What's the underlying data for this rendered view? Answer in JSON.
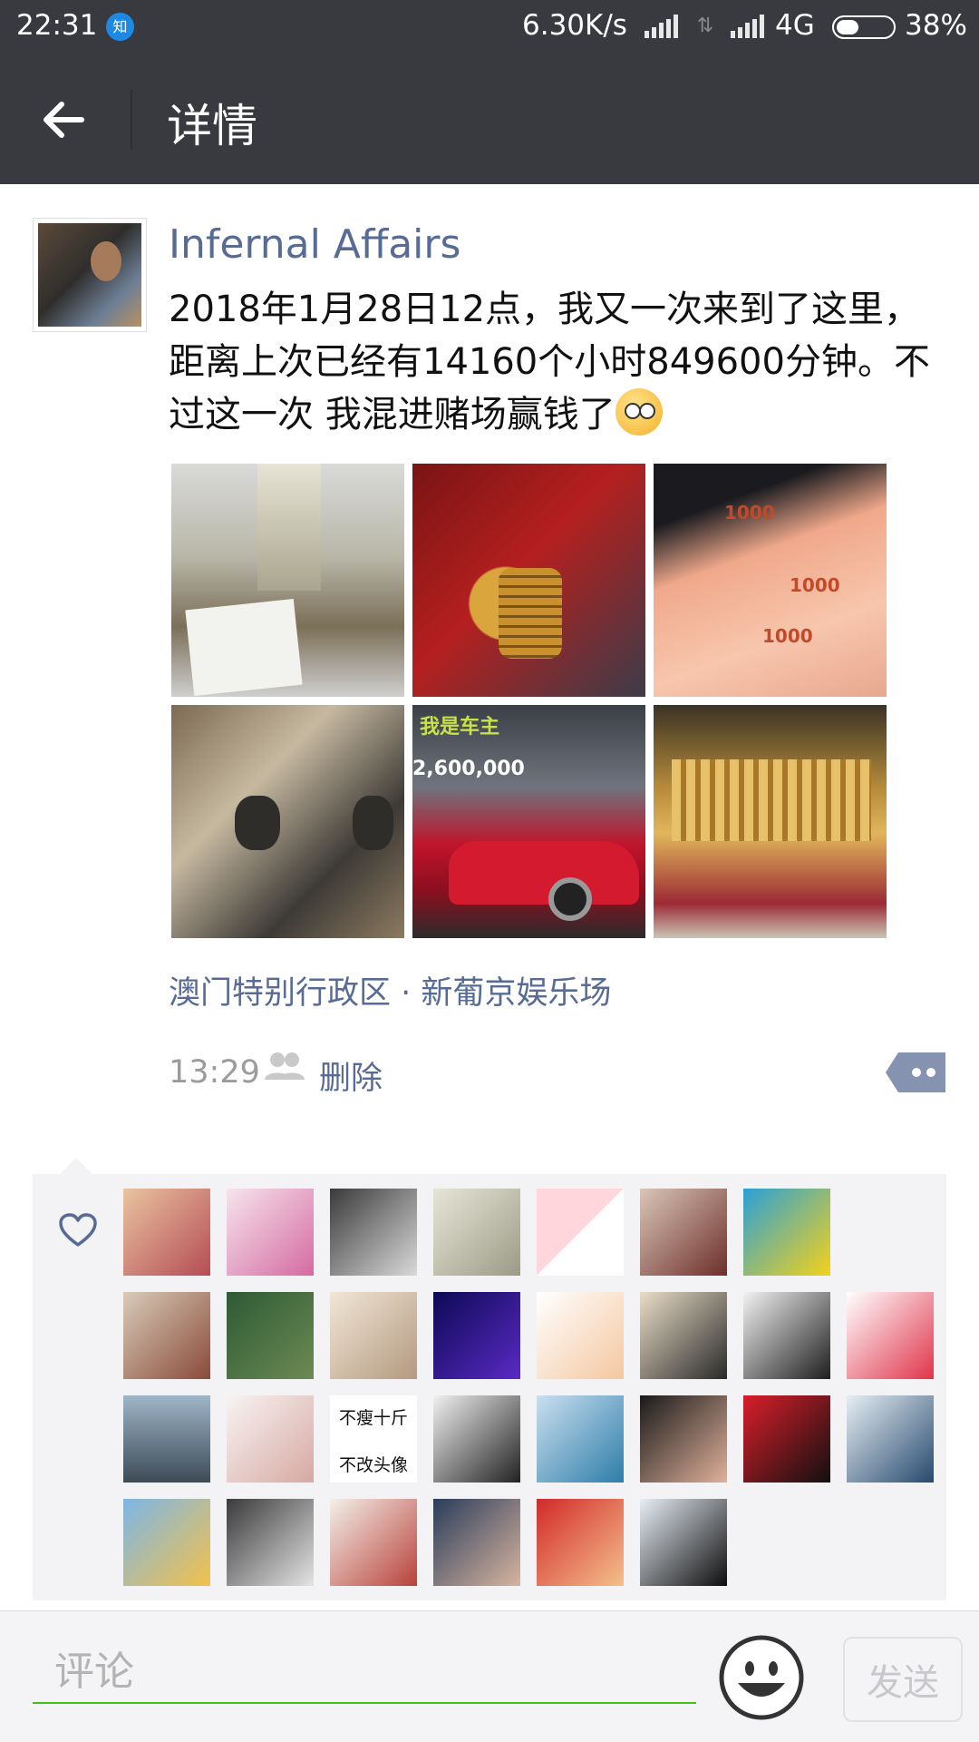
{
  "status_bar": {
    "time": "22:31",
    "app_badge": "知",
    "net_speed": "6.30K/s",
    "network_type": "4G",
    "battery_percent": "38%",
    "battery_level": 0.38
  },
  "header": {
    "title": "详情",
    "back_icon": "arrow-left-icon"
  },
  "post": {
    "author": "Infernal Affairs",
    "text": "2018年1月28日12点，我又一次来到了这里，距离上次已经有14160个小时849600分钟。不过这一次 我混进赌场赢钱了",
    "photo_captions": {
      "car_sign": "2,600,000",
      "car_top": "我是车主",
      "bill": "1000"
    },
    "location": "澳门特别行政区 · 新葡京娱乐场",
    "time": "13:29",
    "delete_label": "删除"
  },
  "likes": {
    "icon": "heart-outline-icon",
    "avatar_text": {
      "line1": "不瘦十斤",
      "line2": "不改头像"
    },
    "count": 29
  },
  "comment_bar": {
    "placeholder": "评论",
    "send_label": "发送",
    "accent_color": "#45c01a"
  }
}
